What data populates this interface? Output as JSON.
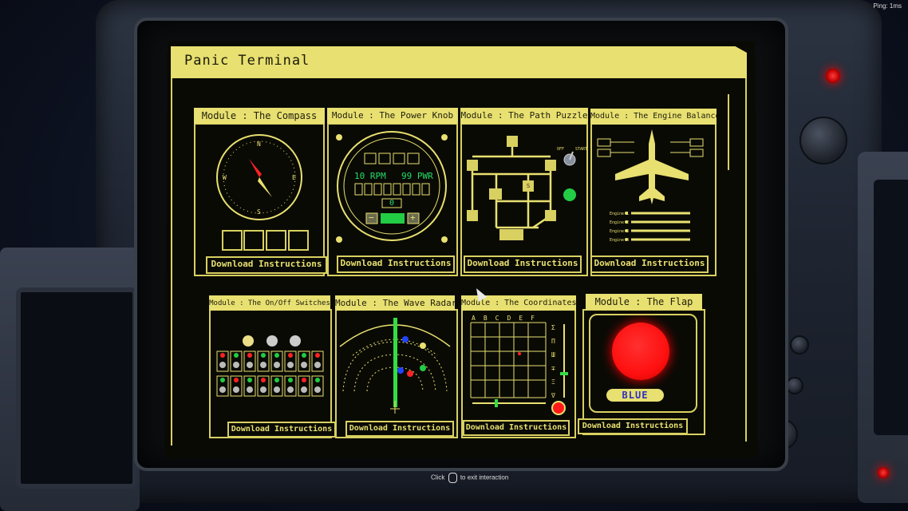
{
  "hud": {
    "ping": "Ping: 1ms",
    "hint_pre": "Click",
    "hint_post": "to exit interaction"
  },
  "terminal": {
    "title": "Panic Terminal",
    "download_label": "Download Instructions"
  },
  "modules": {
    "compass": {
      "header": "Module : The Compass",
      "marks": [
        "N",
        "E",
        "S",
        "W"
      ]
    },
    "power_knob": {
      "header": "Module : The Power Knob",
      "rpm": "10 RPM",
      "pwr": "99 PWR",
      "value": "0",
      "minus": "−",
      "plus": "+"
    },
    "path_puzzle": {
      "header": "Module : The Path Puzzle",
      "toggle_off": "OFF",
      "toggle_start": "START",
      "node_label": "S"
    },
    "engine_balance": {
      "header": "Module : The Engine Balance",
      "engines": [
        "Engine 1",
        "Engine 2",
        "Engine 3",
        "Engine 4"
      ]
    },
    "onoff": {
      "header": "Module : The On/Off Switches"
    },
    "wave_radar": {
      "header": "Module : The Wave Radar"
    },
    "coordinates": {
      "header": "Module : The Coordinates",
      "columns": [
        "A",
        "B",
        "C",
        "D",
        "E",
        "F"
      ],
      "rows": [
        "Σ",
        "Π",
        "Ш",
        "∓",
        "Ξ",
        "∇"
      ]
    },
    "flap": {
      "header": "Module : The Flap",
      "color_label": "BLUE"
    }
  },
  "colors": {
    "panel_yellow": "#e8e070",
    "flap_red": "#ff1a1a",
    "status_green": "#22cc44"
  }
}
